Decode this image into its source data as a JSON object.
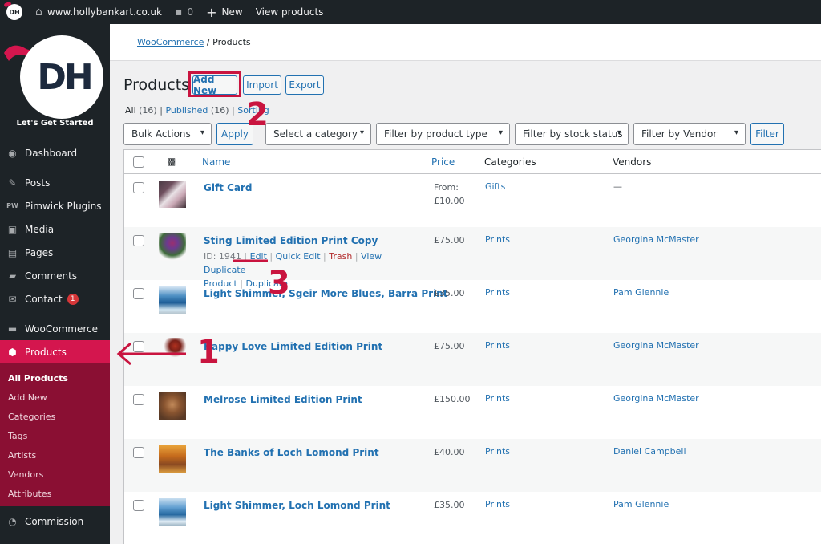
{
  "adminbar": {
    "site": "www.hollybankart.co.uk",
    "comments": "0",
    "new": "New",
    "view": "View products"
  },
  "sidebar": {
    "logo_text": "DH",
    "tagline": "Let's Get Started",
    "items": [
      {
        "label": "Dashboard",
        "icon": "dashboard-icon"
      },
      {
        "label": "Posts",
        "icon": "pin-icon"
      },
      {
        "label": "Pimwick Plugins",
        "icon": "pw-icon"
      },
      {
        "label": "Media",
        "icon": "media-icon"
      },
      {
        "label": "Pages",
        "icon": "pages-icon"
      },
      {
        "label": "Comments",
        "icon": "comment-icon"
      },
      {
        "label": "Contact",
        "icon": "mail-icon",
        "badge": "1"
      },
      {
        "label": "WooCommerce",
        "icon": "woo-icon"
      },
      {
        "label": "Products",
        "icon": "box-icon"
      },
      {
        "label": "Commission",
        "icon": "pie-icon"
      }
    ],
    "submenu": [
      "All Products",
      "Add New",
      "Categories",
      "Tags",
      "Artists",
      "Vendors",
      "Attributes"
    ]
  },
  "breadcrumb": {
    "link": "WooCommerce",
    "sep": "/",
    "current": "Products"
  },
  "page": {
    "title": "Products",
    "add_new": "Add New",
    "import": "Import",
    "export": "Export"
  },
  "subsub": {
    "all": "All",
    "all_count": "(16)",
    "pipe": "|",
    "published": "Published",
    "published_count": "(16)",
    "sorting": "Sorting"
  },
  "filters": {
    "bulk": "Bulk Actions",
    "apply": "Apply",
    "category": "Select a category",
    "type": "Filter by product type",
    "stock": "Filter by stock status",
    "vendor": "Filter by Vendor",
    "filter": "Filter"
  },
  "table": {
    "headers": {
      "name": "Name",
      "price": "Price",
      "categories": "Categories",
      "vendors": "Vendors"
    },
    "rows": [
      {
        "name": "Gift Card",
        "price": "From:",
        "price2": "£10.00",
        "category": "Gifts",
        "vendor": "—"
      },
      {
        "name": "Sting Limited Edition Print Copy",
        "price": "£75.00",
        "category": "Prints",
        "vendor": "Georgina McMaster",
        "actions": {
          "id": "ID: 1941",
          "edit": "Edit",
          "quick": "Quick Edit",
          "trash": "Trash",
          "view": "View",
          "duplicate": "Duplicate",
          "product": "Product",
          "dup_draft": "Duplicate"
        }
      },
      {
        "name": "Light Shimmer, Sgeir More Blues, Barra Print",
        "price": "£35.00",
        "category": "Prints",
        "vendor": "Pam Glennie"
      },
      {
        "name": "Happy Love Limited Edition Print",
        "price": "£75.00",
        "category": "Prints",
        "vendor": "Georgina McMaster"
      },
      {
        "name": "Melrose Limited Edition Print",
        "price": "£150.00",
        "category": "Prints",
        "vendor": "Georgina McMaster"
      },
      {
        "name": "The Banks of Loch Lomond Print",
        "price": "£40.00",
        "category": "Prints",
        "vendor": "Daniel Campbell"
      },
      {
        "name": "Light Shimmer, Loch Lomond Print",
        "price": "£35.00",
        "category": "Prints",
        "vendor": "Pam Glennie"
      }
    ]
  },
  "annotations": {
    "one": "1",
    "two": "2",
    "three": "3"
  },
  "colors": {
    "accent": "#d4164e",
    "link": "#2271b1",
    "annotation": "#c9143f",
    "sidebar": "#1d2327"
  }
}
